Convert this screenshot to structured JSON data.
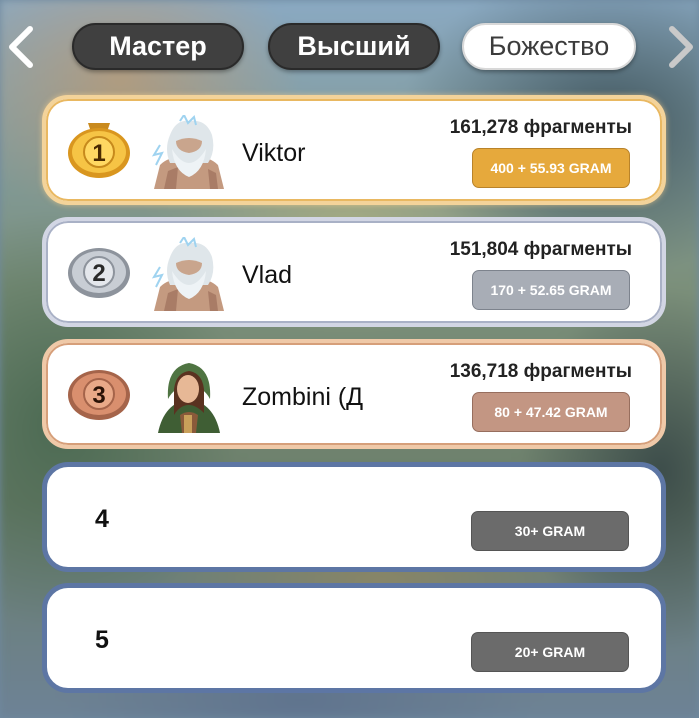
{
  "tabs": [
    {
      "label": "Мастер",
      "active": false
    },
    {
      "label": "Высший",
      "active": false
    },
    {
      "label": "Божество",
      "active": true
    }
  ],
  "nav": {
    "prev_icon": "chevron-left-icon",
    "next_icon": "chevron-right-icon"
  },
  "leaderboard": [
    {
      "rank": "1",
      "name": "Viktor",
      "fragments": "161,278 фрагменты",
      "prize": "400 + 55.93 GRAM",
      "medal": "gold",
      "avatar": "bearded-warrior"
    },
    {
      "rank": "2",
      "name": "Vlad",
      "fragments": "151,804 фрагменты",
      "prize": "170 + 52.65 GRAM",
      "medal": "silver",
      "avatar": "bearded-warrior"
    },
    {
      "rank": "3",
      "name": "Zombini (Д",
      "fragments": "136,718 фрагменты",
      "prize": "80 + 47.42 GRAM",
      "medal": "bronze",
      "avatar": "hooded-archer"
    },
    {
      "rank": "4",
      "prize": "30+ GRAM"
    },
    {
      "rank": "5",
      "prize": "20+ GRAM"
    }
  ],
  "colors": {
    "gold": "#e6a93c",
    "silver": "#a8adb6",
    "bronze": "#c39683",
    "gray": "#6b6b6b",
    "row_border": "#5d76a4"
  }
}
